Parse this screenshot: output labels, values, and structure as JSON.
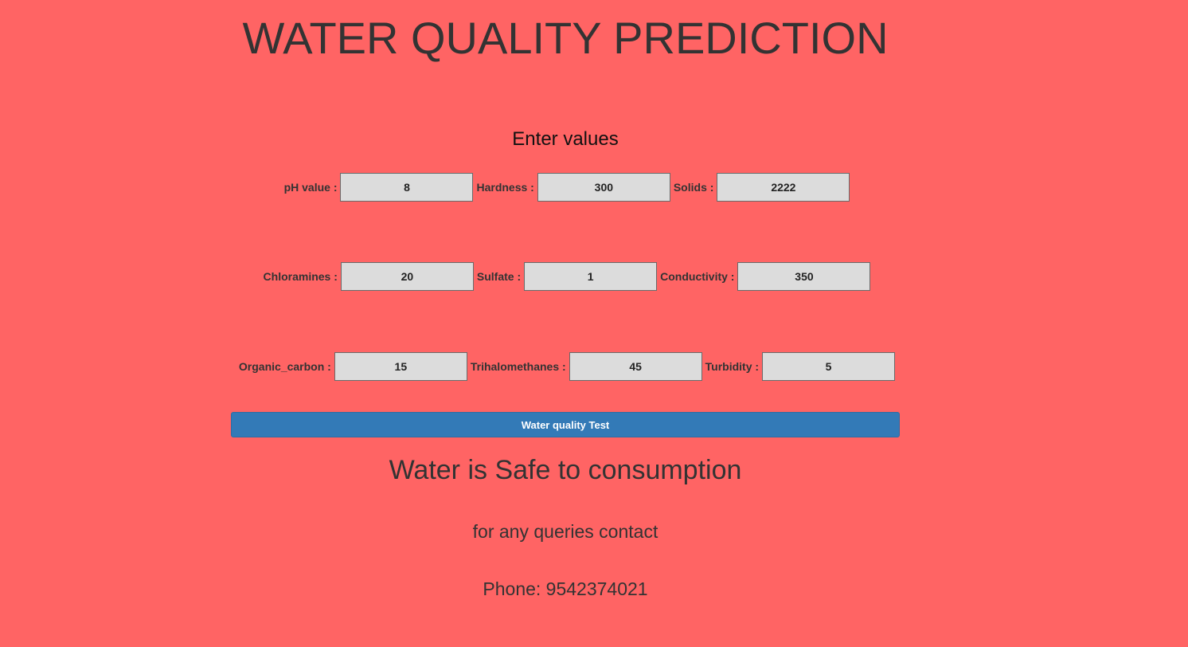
{
  "page": {
    "title": "WATER QUALITY PREDICTION",
    "background_color": "#ff6464",
    "accent_button_color": "#337ab7"
  },
  "form": {
    "heading": "Enter values",
    "rows": [
      [
        {
          "label": "pH value :",
          "value": "8"
        },
        {
          "label": "Hardness :",
          "value": "300"
        },
        {
          "label": "Solids :",
          "value": "2222"
        }
      ],
      [
        {
          "label": "Chloramines :",
          "value": "20"
        },
        {
          "label": "Sulfate :",
          "value": "1"
        },
        {
          "label": "Conductivity :",
          "value": "350"
        }
      ],
      [
        {
          "label": "Organic_carbon :",
          "value": "15"
        },
        {
          "label": "Trihalomethanes :",
          "value": "45"
        },
        {
          "label": "Turbidity :",
          "value": "5"
        }
      ]
    ],
    "submit_label": "Water quality Test"
  },
  "result": {
    "text": "Water is Safe to consumption"
  },
  "footer": {
    "contact_text": "for any queries contact",
    "phone_text": "Phone: 9542374021"
  }
}
